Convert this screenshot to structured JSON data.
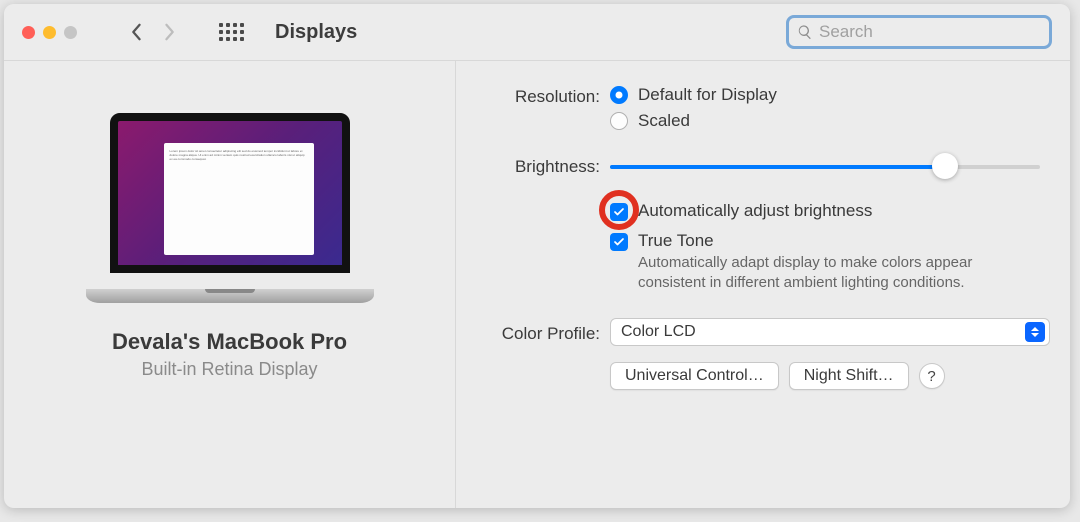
{
  "window": {
    "title": "Displays"
  },
  "search": {
    "placeholder": "Search"
  },
  "display": {
    "name": "Devala's MacBook Pro",
    "subtitle": "Built-in Retina Display"
  },
  "labels": {
    "resolution": "Resolution:",
    "brightness": "Brightness:",
    "color_profile": "Color Profile:"
  },
  "resolution": {
    "default_label": "Default for Display",
    "scaled_label": "Scaled",
    "selected": "default"
  },
  "brightness": {
    "value": 78,
    "auto_label": "Automatically adjust brightness",
    "auto_checked": true
  },
  "true_tone": {
    "label": "True Tone",
    "checked": true,
    "desc": "Automatically adapt display to make colors appear consistent in different ambient lighting conditions."
  },
  "color_profile": {
    "value": "Color LCD"
  },
  "buttons": {
    "universal_control": "Universal Control…",
    "night_shift": "Night Shift…",
    "help": "?"
  }
}
